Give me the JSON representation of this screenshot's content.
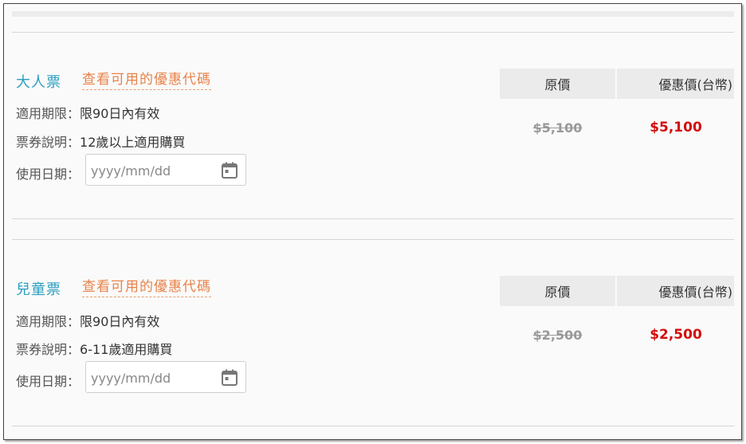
{
  "tickets": [
    {
      "title": "大人票",
      "promo_link": "查看可用的優惠代碼",
      "validity_label": "適用期限：",
      "validity_value": "限90日內有效",
      "desc_label": "票券說明：",
      "desc_value": "12歲以上適用購買",
      "date_label": "使用日期：",
      "date_placeholder": "yyyy/mm/dd",
      "orig_header": "原價",
      "sale_header": "優惠價(台幣)",
      "orig_price": "$5,100",
      "sale_price": "$5,100"
    },
    {
      "title": "兒童票",
      "promo_link": "查看可用的優惠代碼",
      "validity_label": "適用期限：",
      "validity_value": "限90日內有效",
      "desc_label": "票券說明：",
      "desc_value": "6-11歲適用購買",
      "date_label": "使用日期：",
      "date_placeholder": "yyyy/mm/dd",
      "orig_header": "原價",
      "sale_header": "優惠價(台幣)",
      "orig_price": "$2,500",
      "sale_price": "$2,500"
    }
  ],
  "colors": {
    "title": "#2a9fc1",
    "promo": "#e8834a",
    "sale": "#d40d0d",
    "orig": "#999999"
  }
}
